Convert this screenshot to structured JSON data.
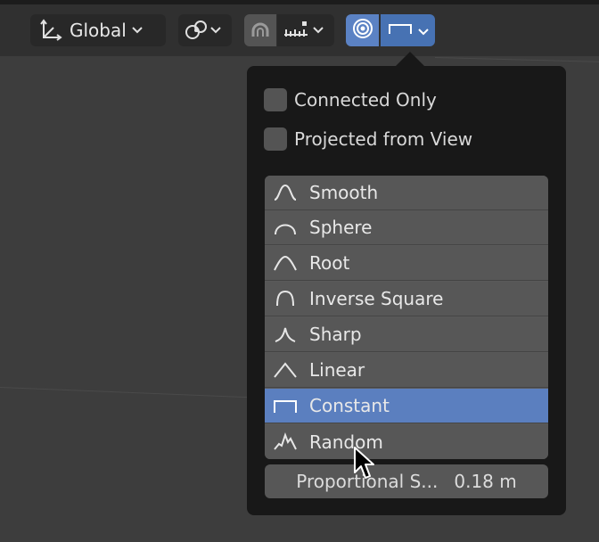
{
  "toolbar": {
    "orientation_label": "Global"
  },
  "proportional_panel": {
    "connected_only_label": "Connected Only",
    "projected_from_view_label": "Projected from View",
    "falloff_items": [
      {
        "label": "Smooth",
        "icon": "smooth-falloff-icon",
        "selected": false
      },
      {
        "label": "Sphere",
        "icon": "sphere-falloff-icon",
        "selected": false
      },
      {
        "label": "Root",
        "icon": "root-falloff-icon",
        "selected": false
      },
      {
        "label": "Inverse Square",
        "icon": "inverse-square-falloff-icon",
        "selected": false
      },
      {
        "label": "Sharp",
        "icon": "sharp-falloff-icon",
        "selected": false
      },
      {
        "label": "Linear",
        "icon": "linear-falloff-icon",
        "selected": false
      },
      {
        "label": "Constant",
        "icon": "constant-falloff-icon",
        "selected": true
      },
      {
        "label": "Random",
        "icon": "random-falloff-icon",
        "selected": false
      }
    ],
    "size_label": "Proportional S...",
    "size_value": "0.18 m"
  },
  "colors": {
    "accent": "#4772b3",
    "selected_item": "#5b7fbf",
    "popup_bg": "#181818",
    "item_bg": "#575757"
  }
}
